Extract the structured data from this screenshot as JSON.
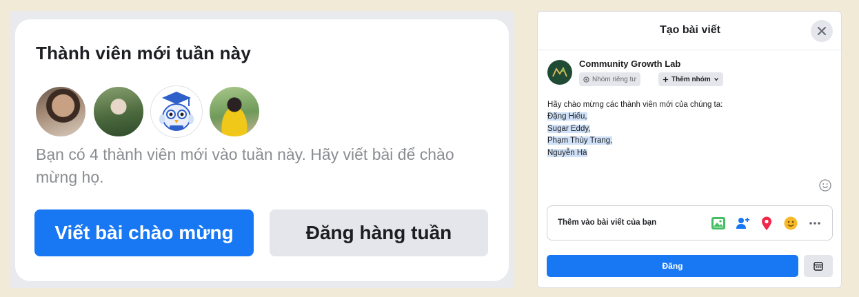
{
  "welcome_card": {
    "title": "Thành viên mới tuần này",
    "avatars": [
      {
        "icon": "member-photo-1"
      },
      {
        "icon": "member-photo-2"
      },
      {
        "icon": "owl-graduate-icon"
      },
      {
        "icon": "member-photo-4"
      }
    ],
    "description": "Bạn có 4 thành viên mới vào tuần này. Hãy viết bài để chào mừng họ.",
    "primary_button": "Viết bài chào mừng",
    "secondary_button": "Đăng hàng tuần",
    "colors": {
      "primary": "#1877f2",
      "secondary": "#e4e6eb"
    }
  },
  "create_post": {
    "title": "Tạo bài viết",
    "group_name": "Community Growth Lab",
    "privacy_label": "Nhóm riêng tư",
    "add_group_label": "Thêm nhóm",
    "post_lines": [
      "Hãy chào mừng các thành viên mới của chúng ta:",
      "Đặng Hiếu,",
      "Sugar Eddy,",
      "Phạm Thùy Trang,",
      "Nguyễn Hà"
    ],
    "add_to_post_label": "Thêm vào bài viết của bạn",
    "add_icons": [
      "photo-icon",
      "tag-people-icon",
      "location-icon",
      "feeling-icon",
      "more-icon"
    ],
    "post_button": "Đăng",
    "colors": {
      "accent": "#1877f2",
      "highlight": "#cfe0f7"
    }
  }
}
